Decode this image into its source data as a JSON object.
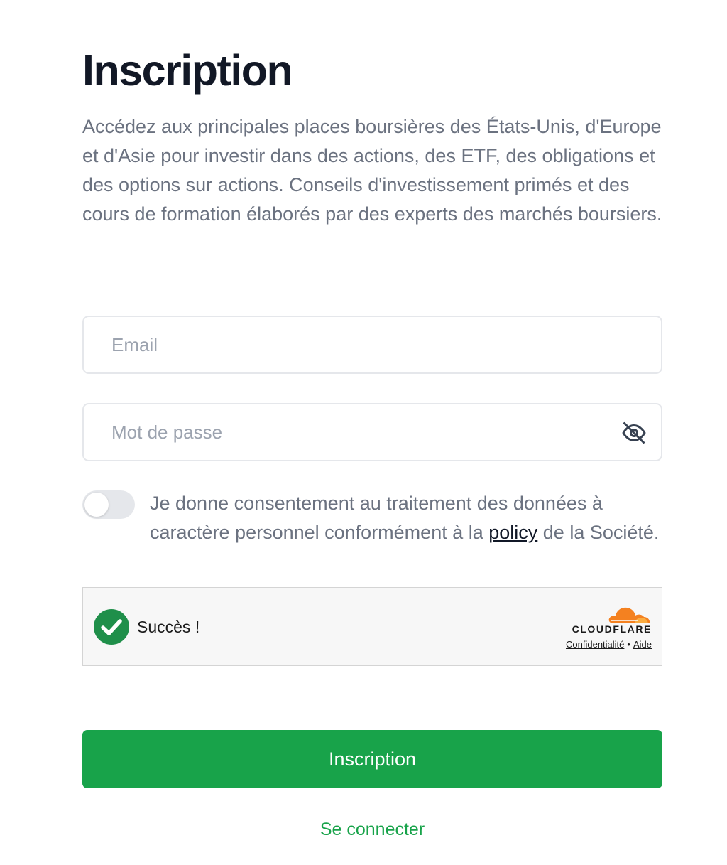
{
  "page": {
    "title": "Inscription",
    "description": "Accédez aux principales places boursières des États-Unis, d'Europe et d'Asie pour investir dans des actions, des ETF, des obligations et des options sur actions. Conseils d'investissement primés et des cours de formation élaborés par des experts des marchés boursiers."
  },
  "form": {
    "email": {
      "placeholder": "Email",
      "value": ""
    },
    "password": {
      "placeholder": "Mot de passe",
      "value": "",
      "visibility_icon": "eye-slash-icon"
    },
    "consent": {
      "checked": false,
      "text_before": "Je donne consentement au traitement des données à caractère personnel conformément à la ",
      "link_label": "policy",
      "text_after": " de la Société."
    },
    "captcha": {
      "status": "Succès !",
      "provider": "CLOUDFLARE",
      "privacy_link": "Confidentialité",
      "separator": "•",
      "help_link": "Aide",
      "status_icon": "check-circle-icon"
    },
    "submit_label": "Inscription",
    "login_link": "Se connecter"
  },
  "colors": {
    "primary": "#18a34a",
    "heading": "#121826",
    "muted_text": "#6b7280",
    "placeholder": "#9ca3af",
    "border": "#e5e7eb",
    "captcha_bg": "#f7f7f7",
    "cloudflare_orange": "#f48120",
    "success_green": "#1f8f4a"
  }
}
